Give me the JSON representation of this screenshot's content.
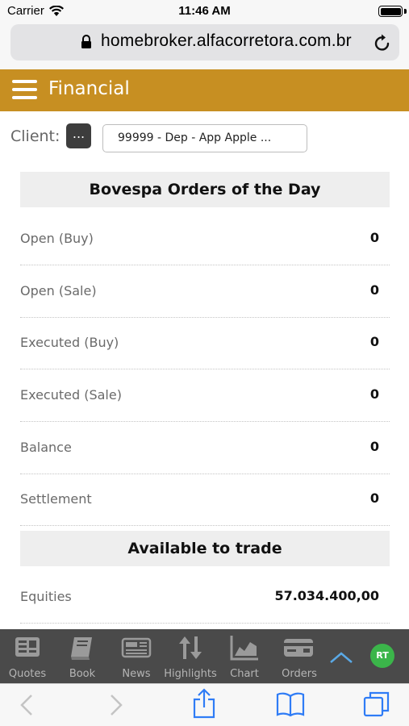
{
  "status_bar": {
    "carrier": "Carrier",
    "time": "11:46 AM"
  },
  "browser": {
    "url": "homebroker.alfacorretora.com.br"
  },
  "header": {
    "title": "Financial"
  },
  "client": {
    "label": "Client:",
    "button_label": "...",
    "value": "99999 - Dep - App Apple  ..."
  },
  "orders_section": {
    "title": "Bovespa Orders of the Day",
    "rows": [
      {
        "label": "Open (Buy)",
        "value": "0"
      },
      {
        "label": "Open (Sale)",
        "value": "0"
      },
      {
        "label": "Executed (Buy)",
        "value": "0"
      },
      {
        "label": "Executed (Sale)",
        "value": "0"
      },
      {
        "label": "Balance",
        "value": "0"
      },
      {
        "label": "Settlement",
        "value": "0"
      }
    ]
  },
  "available_section": {
    "title": "Available to trade",
    "rows": [
      {
        "label": "Equities",
        "value": "57.034.400,00"
      }
    ]
  },
  "tab_bar": {
    "tabs": [
      {
        "label": "Quotes",
        "icon": "quotes-icon"
      },
      {
        "label": "Book",
        "icon": "book-icon"
      },
      {
        "label": "News",
        "icon": "news-icon"
      },
      {
        "label": "Highlights",
        "icon": "highlights-icon"
      },
      {
        "label": "Chart",
        "icon": "chart-icon"
      },
      {
        "label": "Orders",
        "icon": "orders-icon"
      }
    ],
    "badge": "RT"
  },
  "colors": {
    "header": "#c78f22",
    "tab_bar": "#4a4a4a",
    "badge": "#3bb54a",
    "ios_blue": "#2f7cf6"
  }
}
